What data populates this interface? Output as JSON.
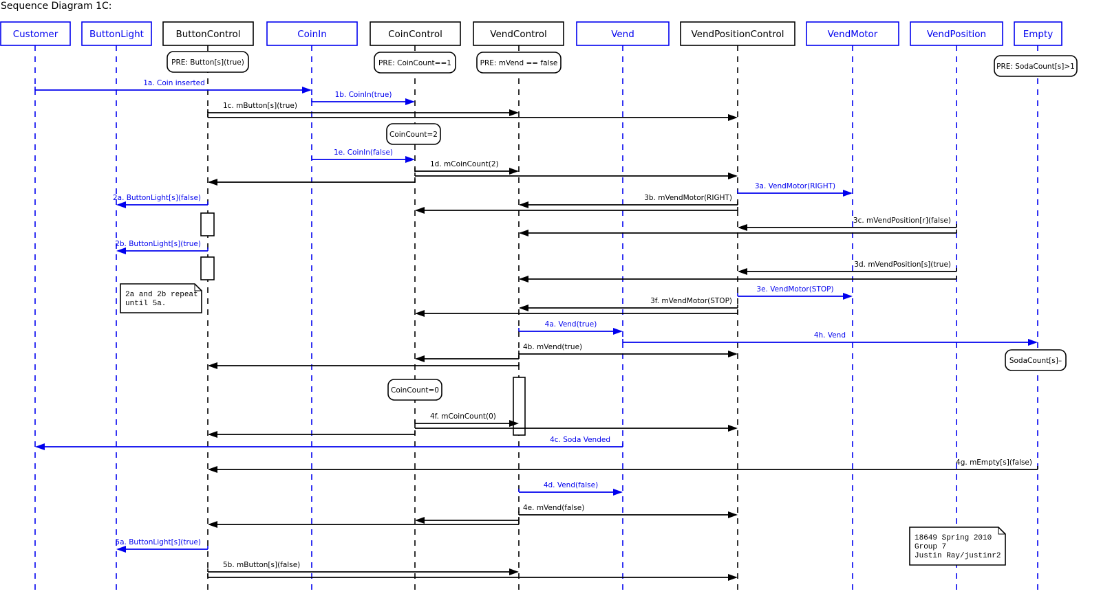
{
  "title": "Sequence Diagram 1C:",
  "colors": {
    "blue": "#0000ee",
    "black": "#000000"
  },
  "lifelines": [
    {
      "id": "Customer",
      "label": "Customer",
      "type": "blue"
    },
    {
      "id": "ButtonLight",
      "label": "ButtonLight",
      "type": "blue"
    },
    {
      "id": "ButtonControl",
      "label": "ButtonControl",
      "type": "black"
    },
    {
      "id": "CoinIn",
      "label": "CoinIn",
      "type": "blue"
    },
    {
      "id": "CoinControl",
      "label": "CoinControl",
      "type": "black"
    },
    {
      "id": "VendControl",
      "label": "VendControl",
      "type": "black"
    },
    {
      "id": "Vend",
      "label": "Vend",
      "type": "blue"
    },
    {
      "id": "VendPositionControl",
      "label": "VendPositionControl",
      "type": "black"
    },
    {
      "id": "VendMotor",
      "label": "VendMotor",
      "type": "blue"
    },
    {
      "id": "VendPosition",
      "label": "VendPosition",
      "type": "blue"
    },
    {
      "id": "Empty",
      "label": "Empty",
      "type": "blue"
    }
  ],
  "states": [
    {
      "on": "ButtonControl",
      "text": "PRE:  Button[s](true)"
    },
    {
      "on": "CoinControl",
      "text": "PRE:  CoinCount==1"
    },
    {
      "on": "VendControl",
      "text": "PRE:  mVend == false"
    },
    {
      "on": "Empty",
      "text": "PRE: SodaCount[s]>1"
    },
    {
      "on": "CoinControl",
      "text": "CoinCount=2"
    },
    {
      "on": "Empty",
      "text": "SodaCount[s]–"
    },
    {
      "on": "CoinControl",
      "text": "CoinCount=0"
    }
  ],
  "messages": [
    {
      "label": "1a. Coin inserted",
      "from": "Customer",
      "to": "CoinIn",
      "color": "blue"
    },
    {
      "label": "1b. CoinIn(true)",
      "from": "CoinIn",
      "to": "CoinControl",
      "color": "blue"
    },
    {
      "label": "1c. mButton[s](true)",
      "from": "ButtonControl",
      "to": "VendControl",
      "color": "black"
    },
    {
      "label": "",
      "from": "ButtonControl",
      "to": "VendPositionControl",
      "color": "black"
    },
    {
      "label": "1e. CoinIn(false)",
      "from": "CoinIn",
      "to": "CoinControl",
      "color": "blue"
    },
    {
      "label": "1d. mCoinCount(2)",
      "from": "CoinControl",
      "to": "VendControl",
      "color": "black"
    },
    {
      "label": "",
      "from": "CoinControl",
      "to": "VendPositionControl",
      "color": "black"
    },
    {
      "label": "",
      "from": "CoinControl",
      "to": "ButtonControl",
      "color": "black"
    },
    {
      "label": "3a. VendMotor(RIGHT)",
      "from": "VendPositionControl",
      "to": "VendMotor",
      "color": "blue"
    },
    {
      "label": "2a. ButtonLight[s](false)",
      "from": "ButtonControl",
      "to": "ButtonLight",
      "color": "blue"
    },
    {
      "label": "3b. mVendMotor(RIGHT)",
      "from": "VendPositionControl",
      "to": "VendControl",
      "color": "black"
    },
    {
      "label": "",
      "from": "VendPositionControl",
      "to": "CoinControl",
      "color": "black"
    },
    {
      "label": "3c. mVendPosition[r](false)",
      "from": "VendPosition",
      "to": "VendPositionControl",
      "color": "black"
    },
    {
      "label": "",
      "from": "VendPosition",
      "to": "VendControl",
      "color": "black"
    },
    {
      "label": "2b. ButtonLight[s](true)",
      "from": "ButtonControl",
      "to": "ButtonLight",
      "color": "blue"
    },
    {
      "label": "3d. mVendPosition[s](true)",
      "from": "VendPosition",
      "to": "VendPositionControl",
      "color": "black"
    },
    {
      "label": "",
      "from": "VendPosition",
      "to": "VendControl",
      "color": "black"
    },
    {
      "label": "3e. VendMotor(STOP)",
      "from": "VendPositionControl",
      "to": "VendMotor",
      "color": "blue"
    },
    {
      "label": "3f. mVendMotor(STOP)",
      "from": "VendPositionControl",
      "to": "VendControl",
      "color": "black"
    },
    {
      "label": "",
      "from": "VendPositionControl",
      "to": "CoinControl",
      "color": "black"
    },
    {
      "label": "4a. Vend(true)",
      "from": "VendControl",
      "to": "Vend",
      "color": "blue"
    },
    {
      "label": "4h.  Vend",
      "from": "Vend",
      "to": "Empty",
      "color": "blue"
    },
    {
      "label": "4b. mVend(true)",
      "from": "VendControl",
      "to": "VendPositionControl",
      "color": "black"
    },
    {
      "label": "",
      "from": "VendControl",
      "to": "CoinControl",
      "color": "black"
    },
    {
      "label": "",
      "from": "VendControl",
      "to": "ButtonControl",
      "color": "black"
    },
    {
      "label": "4f. mCoinCount(0)",
      "from": "CoinControl",
      "to": "VendControl",
      "color": "black"
    },
    {
      "label": "",
      "from": "CoinControl",
      "to": "VendPositionControl",
      "color": "black"
    },
    {
      "label": "",
      "from": "CoinControl",
      "to": "ButtonControl",
      "color": "black"
    },
    {
      "label": "4c. Soda Vended",
      "from": "Vend",
      "to": "Customer",
      "color": "blue"
    },
    {
      "label": "4g. mEmpty[s](false)",
      "from": "Empty",
      "to": "ButtonControl",
      "color": "black"
    },
    {
      "label": "4d. Vend(false)",
      "from": "VendControl",
      "to": "Vend",
      "color": "blue"
    },
    {
      "label": "4e. mVend(false)",
      "from": "VendControl",
      "to": "VendPositionControl",
      "color": "black"
    },
    {
      "label": "",
      "from": "VendControl",
      "to": "CoinControl",
      "color": "black"
    },
    {
      "label": "",
      "from": "VendControl",
      "to": "ButtonControl",
      "color": "black"
    },
    {
      "label": "5a. ButtonLight[s](true)",
      "from": "ButtonControl",
      "to": "ButtonLight",
      "color": "blue"
    },
    {
      "label": "5b. mButton[s](false)",
      "from": "ButtonControl",
      "to": "VendControl",
      "color": "black"
    },
    {
      "label": "",
      "from": "ButtonControl",
      "to": "VendPositionControl",
      "color": "black"
    }
  ],
  "notes": [
    {
      "lines": [
        "2a and 2b repeat",
        "until 5a."
      ]
    },
    {
      "lines": [
        "18649 Spring 2010",
        "Group 7",
        "Justin Ray/justinr2"
      ]
    }
  ]
}
